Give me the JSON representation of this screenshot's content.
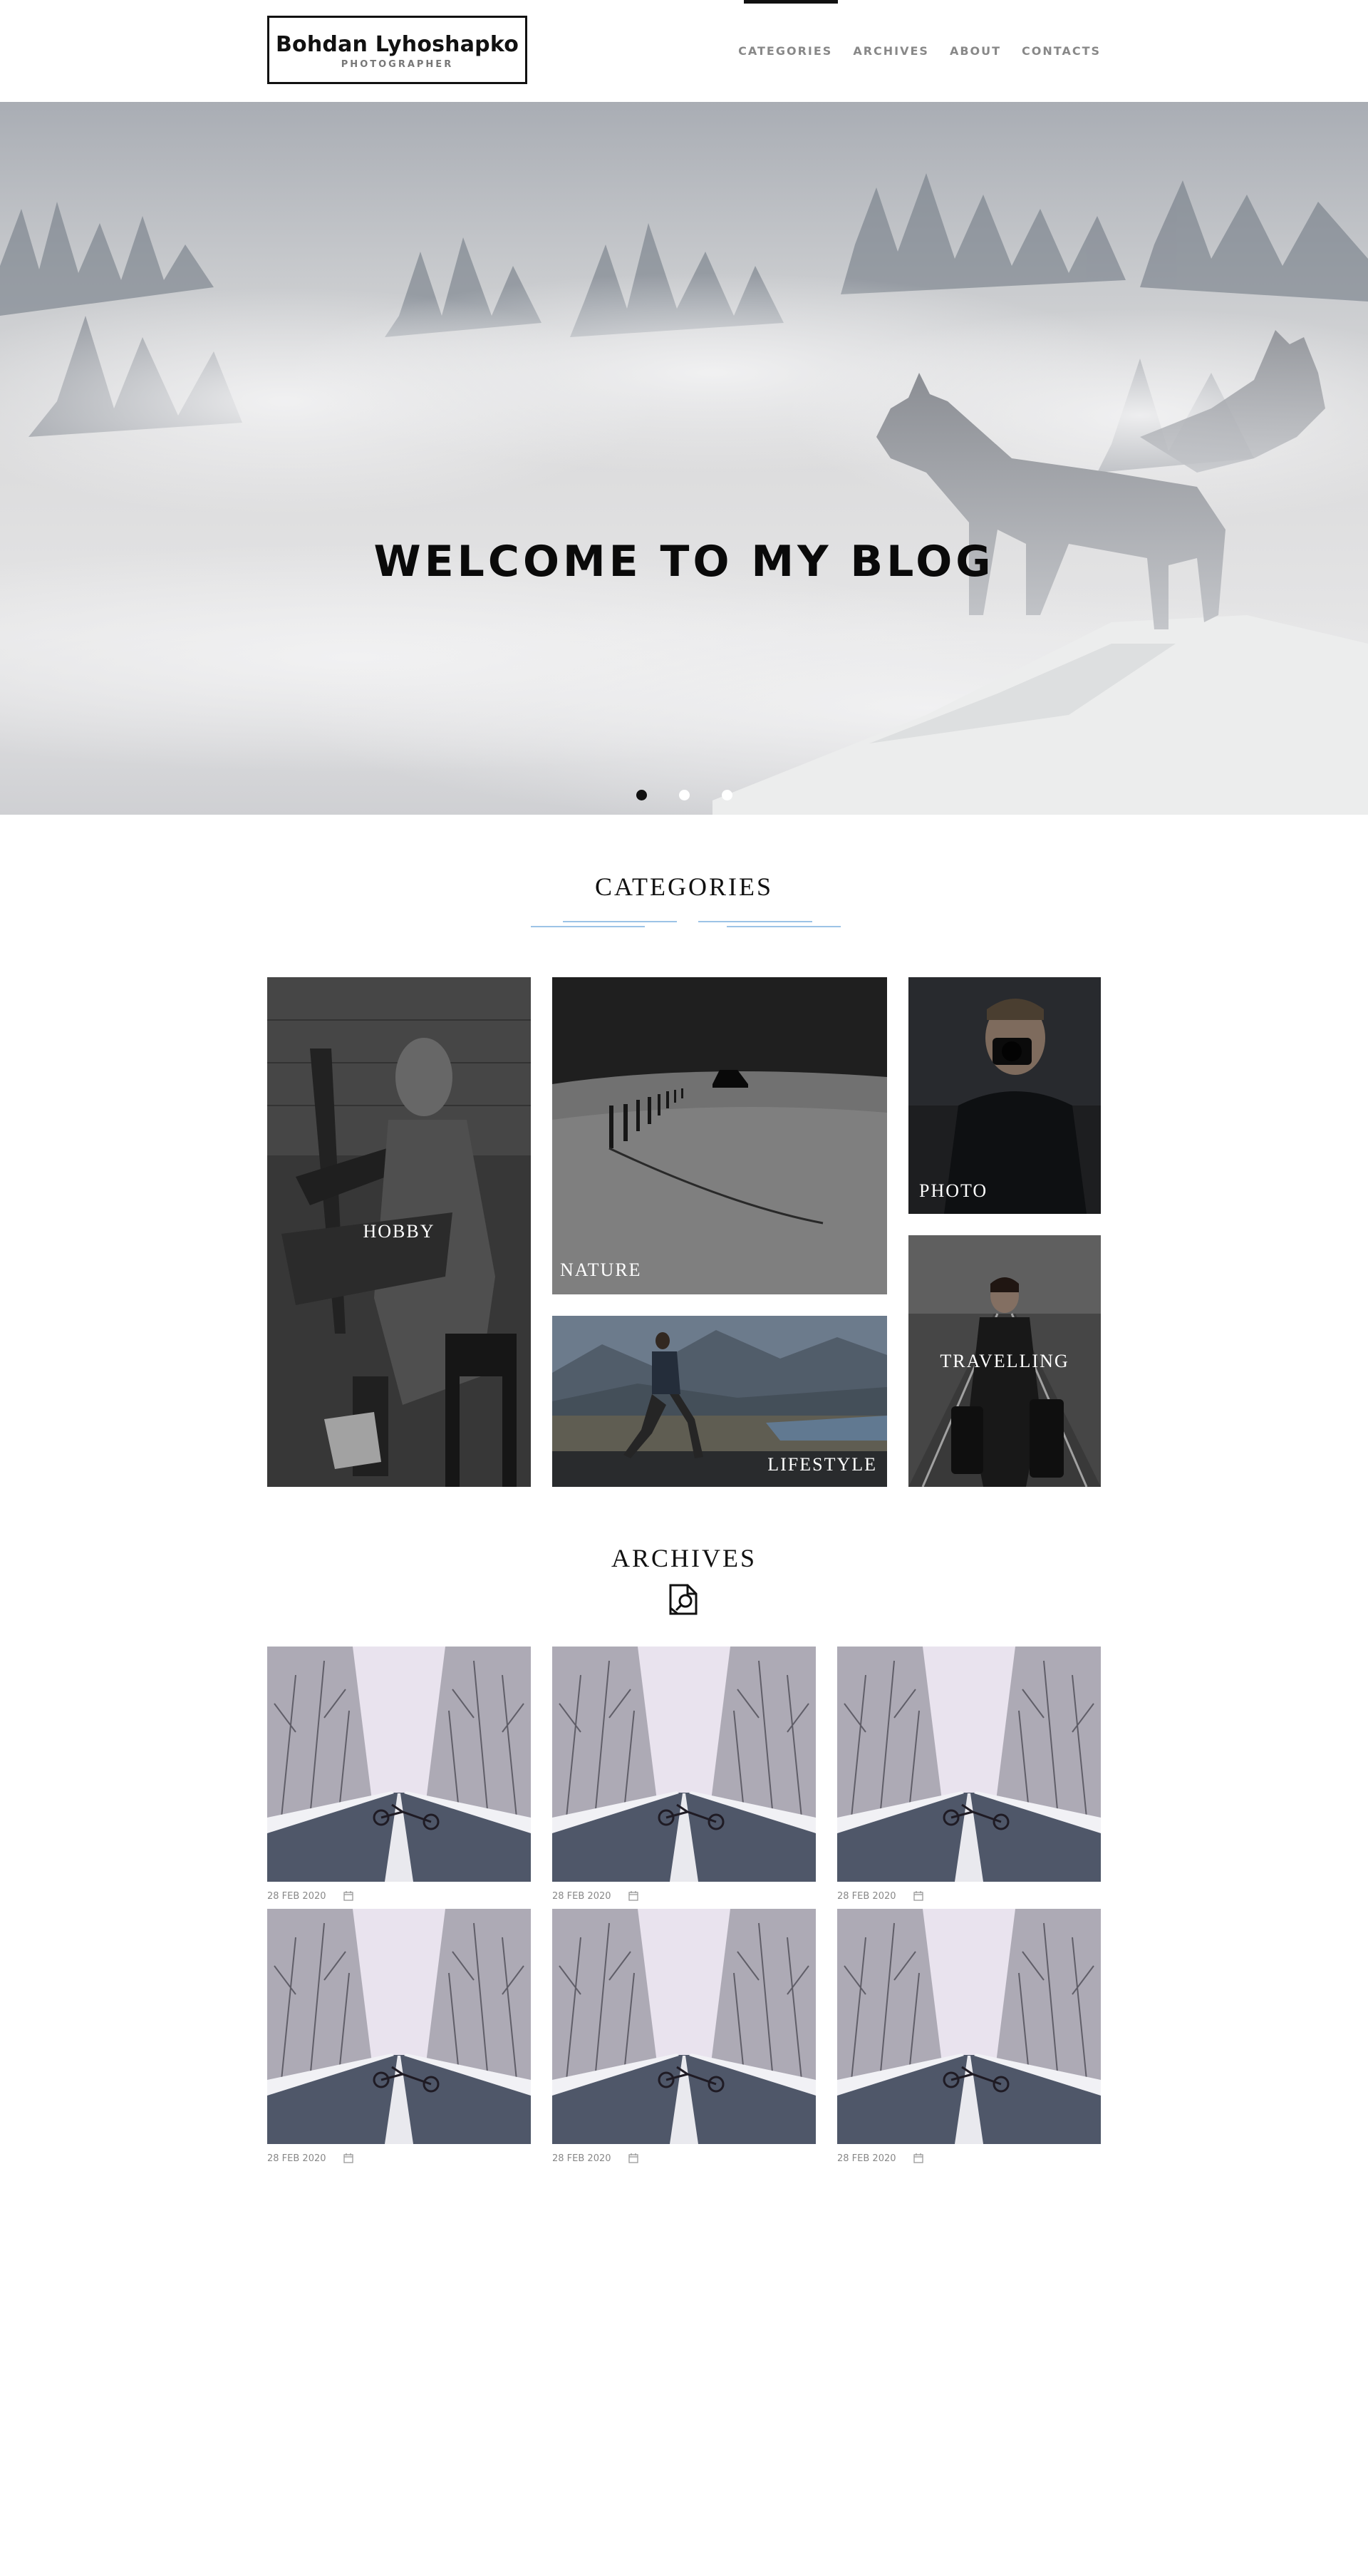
{
  "header": {
    "logo_name": "Bohdan Lyhoshapko",
    "logo_sub": "PHOTOGRAPHER",
    "nav": [
      {
        "label": "CATEGORIES",
        "active": true
      },
      {
        "label": "ARCHIVES",
        "active": false
      },
      {
        "label": "ABOUT",
        "active": false
      },
      {
        "label": "CONTACTS",
        "active": false
      }
    ]
  },
  "hero": {
    "title": "WELCOME TO MY BLOG",
    "slides_total": 3,
    "active_slide": 1
  },
  "categories": {
    "title": "CATEGORIES",
    "items": [
      {
        "label": "HOBBY"
      },
      {
        "label": "NATURE"
      },
      {
        "label": "PHOTO"
      },
      {
        "label": "LIFESTYLE"
      },
      {
        "label": "TRAVELLING"
      }
    ]
  },
  "archives": {
    "title": "ARCHIVES",
    "icon": "archive-search-icon",
    "items": [
      {
        "date": "28 FEB 2020"
      },
      {
        "date": "28 FEB 2020"
      },
      {
        "date": "28 FEB 2020"
      },
      {
        "date": "28 FEB 2020"
      },
      {
        "date": "28 FEB 2020"
      },
      {
        "date": "28 FEB 2020"
      }
    ]
  },
  "colors": {
    "accent_line": "#9cc3e6",
    "text_dark": "#111111",
    "nav_gray": "#888888"
  }
}
